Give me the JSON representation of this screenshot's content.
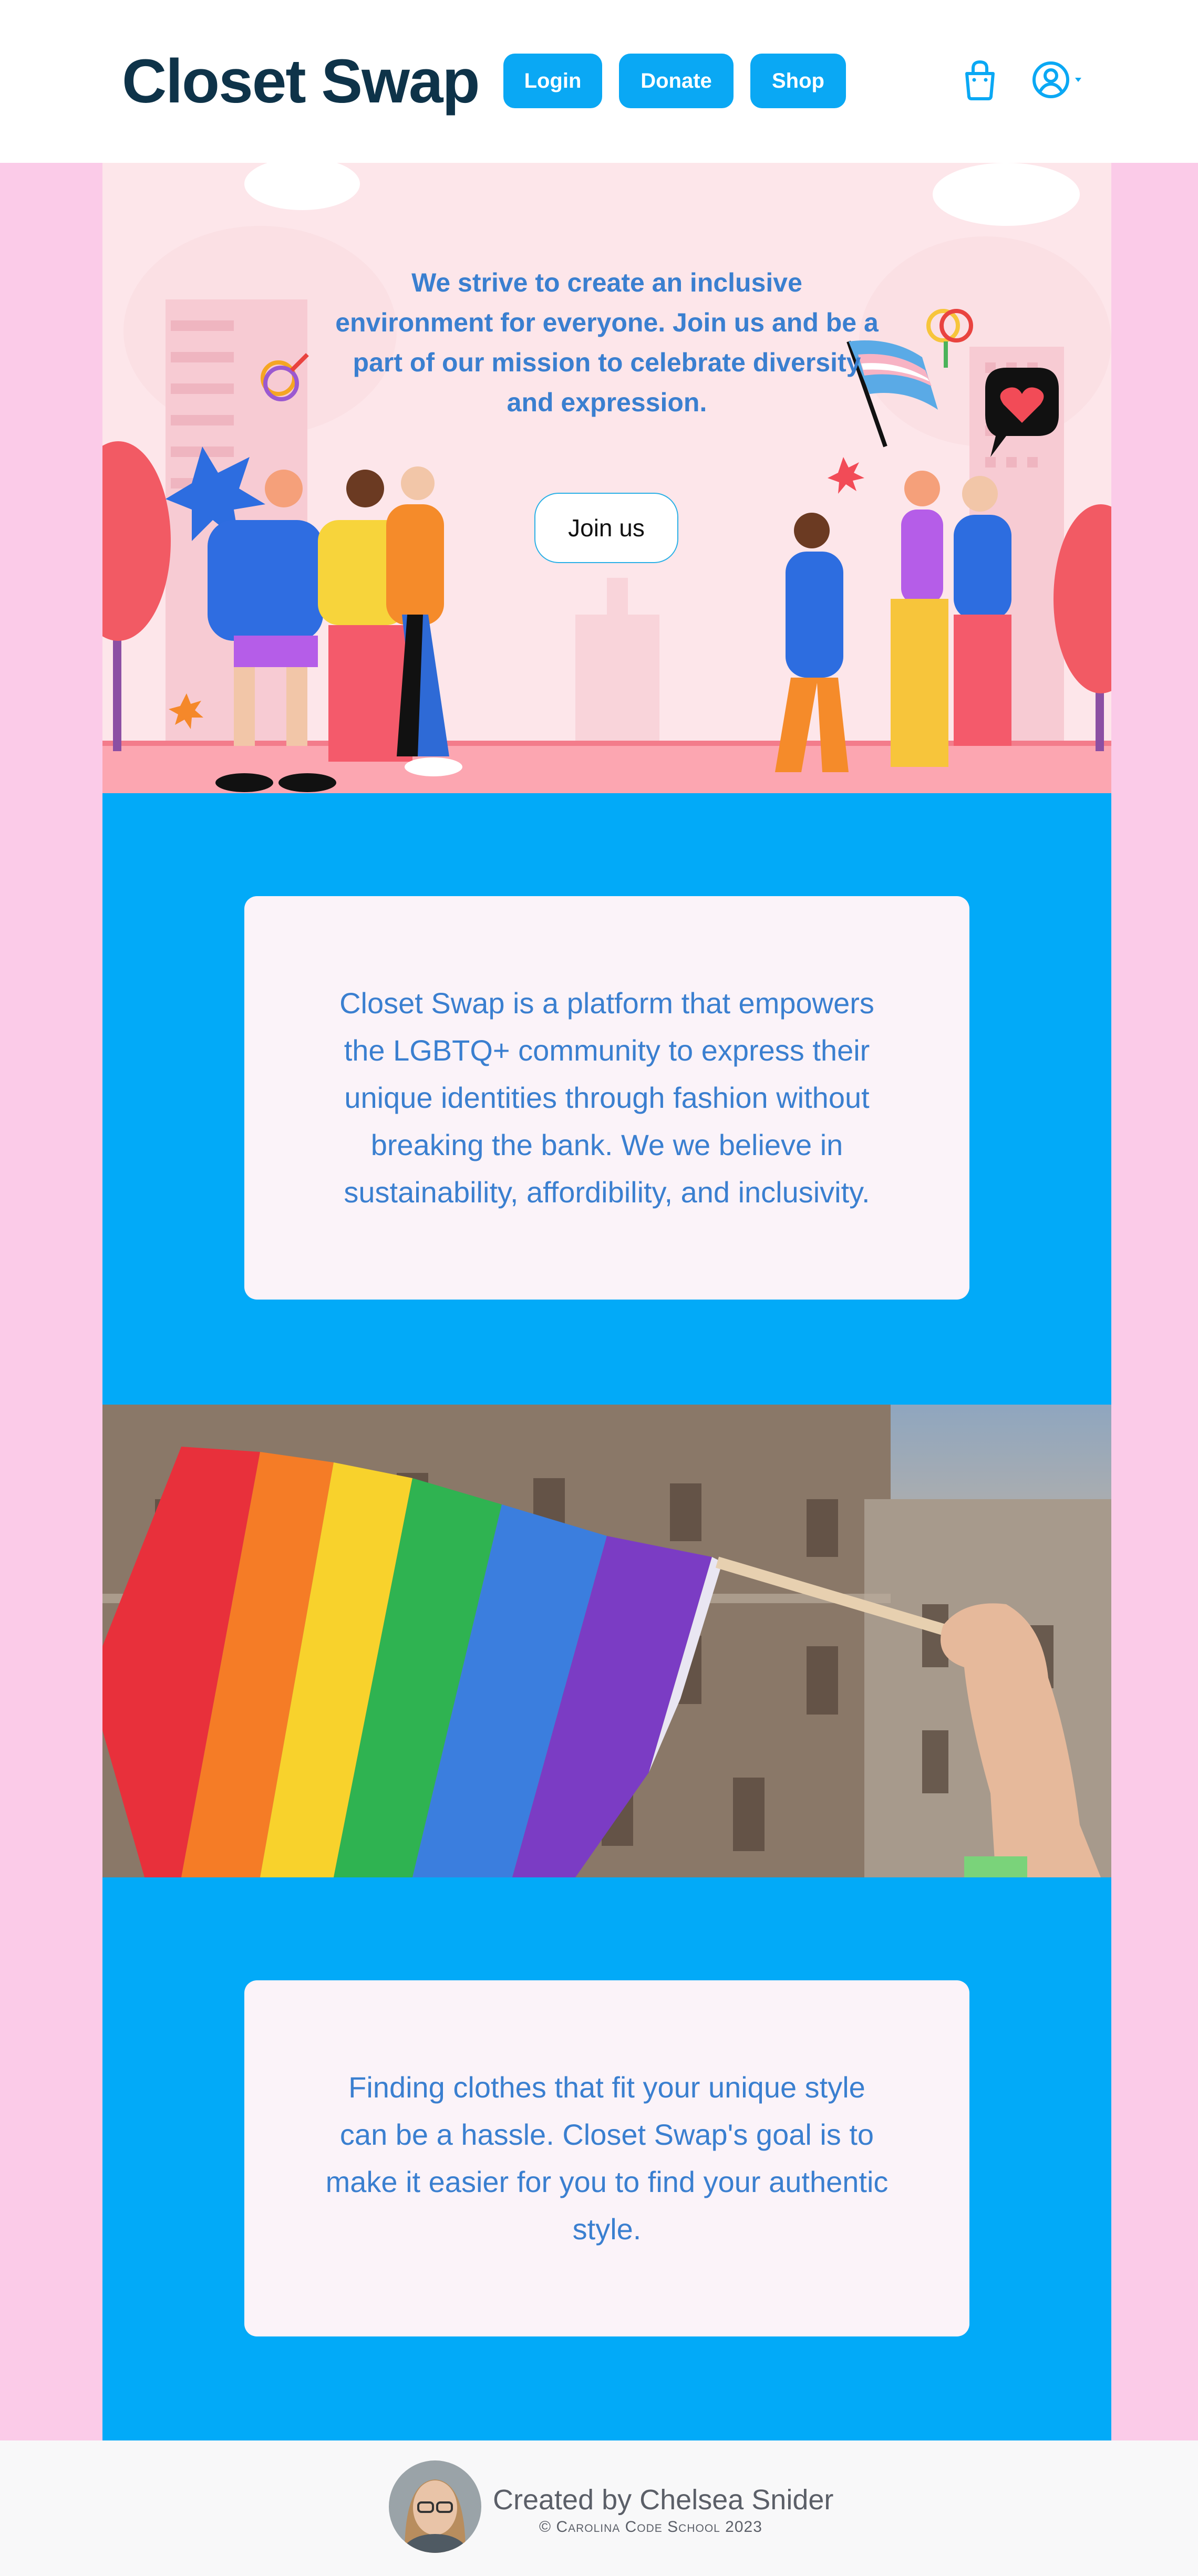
{
  "header": {
    "brand": "Closet Swap",
    "nav": [
      "Login",
      "Donate",
      "Shop"
    ],
    "icons": [
      "shopping-bag-icon",
      "user-account-icon"
    ]
  },
  "hero": {
    "text": "We strive to create an inclusive environment for everyone. Join us and be a part of our mission to celebrate diversity and expression.",
    "button": "Join us"
  },
  "cards": [
    "Closet Swap is a platform that empowers the LGBTQ+ community to express their unique identities through fashion without breaking the bank. We we believe in sustainability, affordibility, and inclusivity.",
    "Finding clothes that fit your unique style can be a hassle. Closet Swap's goal is to make it easier for you to find your authentic style."
  ],
  "footer": {
    "credit": "Created by Chelsea Snider",
    "copyright": "© Carolina Code School 2023"
  },
  "colors": {
    "primary": "#02aaf8",
    "brand_text": "#0e3349",
    "body_text": "#3a7fd0",
    "side_pink": "#fbcbe8",
    "card_bg": "#fbf3f9"
  }
}
